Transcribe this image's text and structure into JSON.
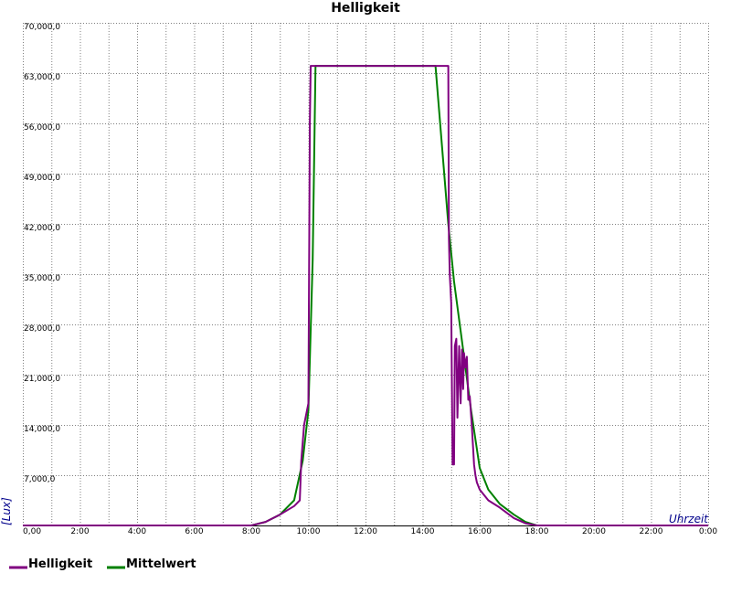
{
  "chart_data": {
    "type": "line",
    "title": "Helligkeit",
    "xlabel": "Uhrzeit",
    "ylabel": "[Lux]",
    "x_unit": "hour",
    "xlim": [
      0,
      24
    ],
    "ylim": [
      0,
      70000
    ],
    "grid": true,
    "legend_position": "bottom-left",
    "x_tick_labels": [
      "0,00",
      "2:00",
      "4:00",
      "6:00",
      "8:00",
      "10:00",
      "12:00",
      "14:00",
      "16:00",
      "18:00",
      "20:00",
      "22:00",
      "0:00"
    ],
    "y_tick_labels": [
      "70,000,0",
      "63,000,0",
      "56,000,0",
      "49,000,0",
      "42,000,0",
      "35,000,0",
      "28,000,0",
      "21,000,0",
      "14,000,0",
      "7,000,0"
    ],
    "colors": {
      "Helligkeit": "#800080",
      "Mittelwert": "#008000"
    },
    "series": [
      {
        "name": "Helligkeit",
        "x": [
          0,
          8.0,
          8.5,
          9.0,
          9.5,
          9.7,
          9.75,
          9.85,
          10.0,
          10.05,
          10.08,
          10.12,
          10.15,
          14.6,
          14.9,
          14.92,
          14.95,
          15.0,
          15.05,
          15.1,
          15.13,
          15.18,
          15.22,
          15.28,
          15.33,
          15.38,
          15.42,
          15.45,
          15.5,
          15.55,
          15.6,
          15.65,
          15.72,
          15.8,
          15.85,
          15.9,
          16.0,
          16.3,
          16.7,
          17.2,
          17.6,
          18.0,
          24.0
        ],
        "y": [
          0,
          0,
          500,
          1500,
          2700,
          3500,
          9000,
          14000,
          17000,
          56000,
          64000,
          64000,
          64000,
          64000,
          64000,
          40000,
          35000,
          31000,
          8500,
          8500,
          25000,
          26000,
          15000,
          25000,
          17000,
          24500,
          19000,
          24000,
          22000,
          23500,
          17500,
          18000,
          14000,
          8500,
          7000,
          6000,
          5000,
          3500,
          2500,
          1000,
          300,
          0,
          0
        ]
      },
      {
        "name": "Mittelwert",
        "x": [
          0,
          8.0,
          8.5,
          9.0,
          9.5,
          9.8,
          10.0,
          10.15,
          10.25,
          14.45,
          14.9,
          15.1,
          15.4,
          15.7,
          16.0,
          16.3,
          16.7,
          17.2,
          17.6,
          18.0,
          24.0
        ],
        "y": [
          0,
          0,
          500,
          1500,
          3500,
          9000,
          16000,
          37000,
          64000,
          64000,
          42000,
          34000,
          25000,
          16000,
          8000,
          5000,
          3000,
          1500,
          500,
          0,
          0
        ]
      }
    ]
  }
}
